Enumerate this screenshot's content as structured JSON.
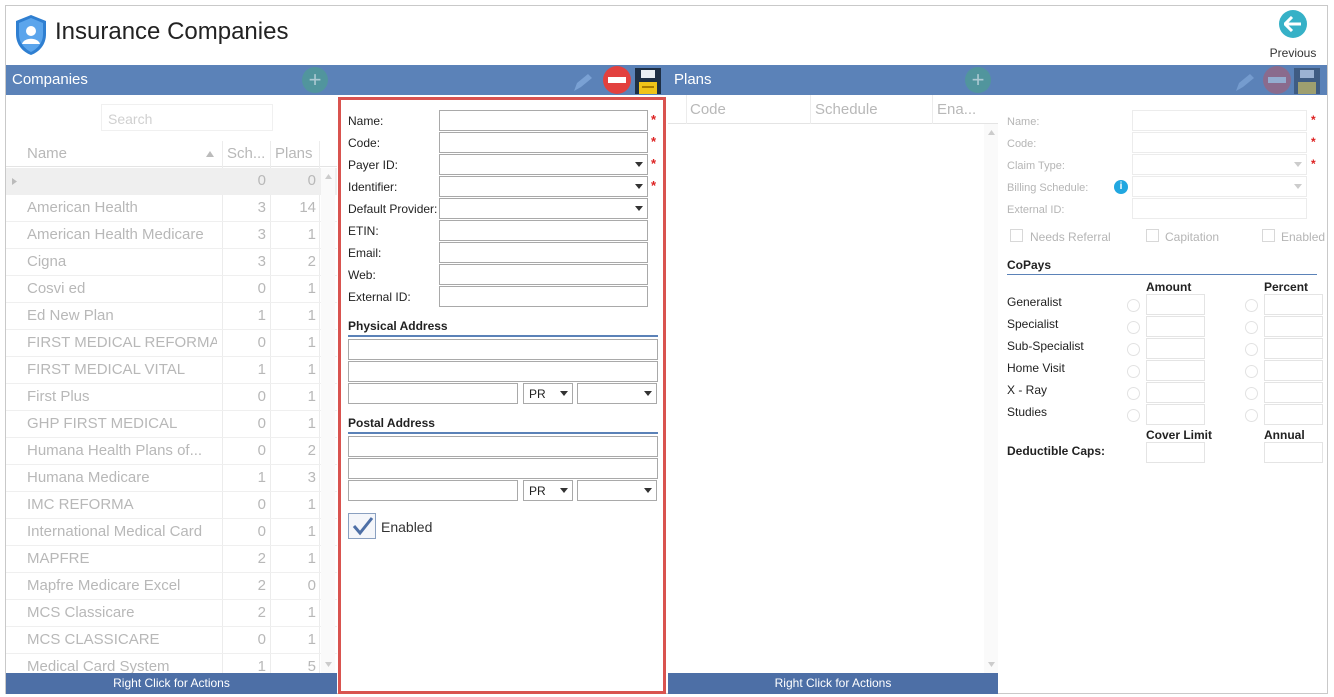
{
  "app": {
    "title": "Insurance Companies",
    "previous_label": "Previous"
  },
  "companies": {
    "title": "Companies",
    "search_placeholder": "Search",
    "columns": {
      "name": "Name",
      "schedules": "Sch...",
      "plans": "Plans"
    },
    "rows": [
      {
        "name": "",
        "schedules": "0",
        "plans": "0"
      },
      {
        "name": "American Health",
        "schedules": "3",
        "plans": "14"
      },
      {
        "name": "American Health Medicare",
        "schedules": "3",
        "plans": "1"
      },
      {
        "name": "Cigna",
        "schedules": "3",
        "plans": "2"
      },
      {
        "name": "Cosvi ed",
        "schedules": "0",
        "plans": "1"
      },
      {
        "name": "Ed New Plan",
        "schedules": "1",
        "plans": "1"
      },
      {
        "name": "FIRST MEDICAL REFORMA",
        "schedules": "0",
        "plans": "1"
      },
      {
        "name": "FIRST MEDICAL VITAL",
        "schedules": "1",
        "plans": "1"
      },
      {
        "name": "First Plus",
        "schedules": "0",
        "plans": "1"
      },
      {
        "name": "GHP FIRST MEDICAL",
        "schedules": "0",
        "plans": "1"
      },
      {
        "name": "Humana Health Plans of...",
        "schedules": "0",
        "plans": "2"
      },
      {
        "name": "Humana Medicare",
        "schedules": "1",
        "plans": "3"
      },
      {
        "name": "IMC REFORMA",
        "schedules": "0",
        "plans": "1"
      },
      {
        "name": "International Medical Card",
        "schedules": "0",
        "plans": "1"
      },
      {
        "name": "MAPFRE",
        "schedules": "2",
        "plans": "1"
      },
      {
        "name": "Mapfre Medicare Excel",
        "schedules": "2",
        "plans": "0"
      },
      {
        "name": "MCS Classicare",
        "schedules": "2",
        "plans": "1"
      },
      {
        "name": "MCS CLASSICARE",
        "schedules": "0",
        "plans": "1"
      },
      {
        "name": "Medical Card System",
        "schedules": "1",
        "plans": "5"
      }
    ],
    "footer": "Right Click for Actions"
  },
  "company_form": {
    "name_label": "Name:",
    "code_label": "Code:",
    "payer_id_label": "Payer ID:",
    "identifier_label": "Identifier:",
    "default_provider_label": "Default Provider:",
    "etin_label": "ETIN:",
    "email_label": "Email:",
    "web_label": "Web:",
    "external_id_label": "External ID:",
    "required_mark": "*",
    "physical_address_title": "Physical Address",
    "physical_state": "PR",
    "postal_address_title": "Postal Address",
    "postal_state": "PR",
    "enabled_label": "Enabled",
    "enabled_checked": true
  },
  "plans": {
    "title": "Plans",
    "columns": {
      "code": "Code",
      "schedule": "Schedule",
      "enabled": "Ena..."
    },
    "footer": "Right Click for Actions"
  },
  "plan_details": {
    "name_label": "Name:",
    "code_label": "Code:",
    "claim_type_label": "Claim Type:",
    "billing_schedule_label": "Billing Schedule:",
    "info_icon_text": "i",
    "external_id_label": "External ID:",
    "needs_referral_label": "Needs Referral",
    "capitation_label": "Capitation",
    "enabled_label": "Enabled",
    "copays_title": "CoPays",
    "amount_header": "Amount",
    "percent_header": "Percent",
    "copay_rows": [
      "Generalist",
      "Specialist",
      "Sub-Specialist",
      "Home Visit",
      "X - Ray",
      "Studies"
    ],
    "cover_limit_header": "Cover Limit",
    "annual_header": "Annual",
    "deductible_caps_label": "Deductible Caps:"
  },
  "colors": {
    "header_blue": "#5b82b8",
    "footer_blue": "#4d6fa6",
    "highlight_red": "#d9534f",
    "accent_teal": "#36b1c7"
  }
}
